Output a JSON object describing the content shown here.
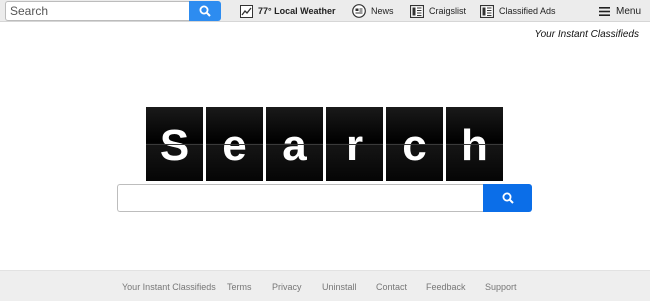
{
  "toolbar": {
    "search_placeholder": "Search",
    "weather_temp": "77°",
    "weather_label": "Local Weather",
    "news_label": "News",
    "craigslist_label": "Craigslist",
    "classified_label": "Classified Ads",
    "menu_label": "Menu",
    "icons": [
      "search-icon",
      "weather-chart-icon",
      "news-icon",
      "newspaper-icon",
      "newspaper-icon",
      "hamburger-icon"
    ]
  },
  "tagline": "Your Instant Classifieds",
  "logo_letters": [
    "S",
    "e",
    "a",
    "r",
    "c",
    "h"
  ],
  "main_search": {
    "value": "",
    "button_icon": "search-icon"
  },
  "footer": {
    "links": [
      "Your Instant Classifieds",
      "Terms",
      "Privacy",
      "Uninstall",
      "Contact",
      "Feedback",
      "Support"
    ]
  },
  "colors": {
    "toolbar_bg": "#ececec",
    "search_button": "#2d8cf0",
    "main_search_button": "#0b6ee8",
    "tile_bg": "#000000",
    "footer_bg": "#eeeeee"
  }
}
